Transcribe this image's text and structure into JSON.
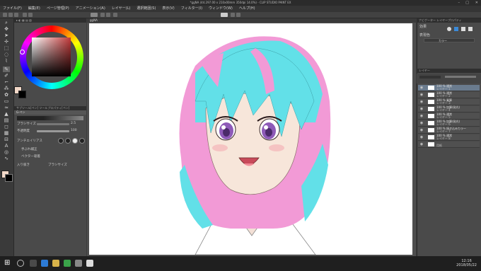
{
  "window": {
    "title": "*ggNA (44.297.00 x 210x00mm 350dpi 14.0%) - CLIP STUDIO PAINT EX"
  },
  "menu": [
    "ファイル(F)",
    "編集(E)",
    "ページ管理(P)",
    "アニメーション(A)",
    "レイヤー(L)",
    "選択範囲(S)",
    "表示(V)",
    "フィルター(I)",
    "ウィンドウ(W)",
    "ヘルプ(H)"
  ],
  "canvas_tab": "ggNA",
  "brush_panel": {
    "header": "サブツール[ペン] ツールプロパティ[ペン]",
    "tool_name": "G-ペン",
    "brush_size_label": "ブラシサイズ",
    "brush_size_value": "2.5",
    "opacity_label": "不透明度",
    "opacity_value": "100",
    "antialias_label": "アンチエイリアス",
    "stabilization_label": "手ぶれ補正",
    "vector_label": "ベクター吸着",
    "input_label": "入り抜き",
    "input_value": "ブラシサイズ"
  },
  "right_panel": {
    "nav_header": "ナビゲーター レイヤープロパティ",
    "effect_label": "効果",
    "expression_label": "表現色",
    "expression_value": "カラー",
    "layer_header": "レイヤー",
    "layers": [
      {
        "mode": "100 % 通常",
        "name": "レイヤー 1",
        "selected": true
      },
      {
        "mode": "100 % 通常",
        "name": "レイヤー 2",
        "selected": false
      },
      {
        "mode": "100 % 乗算",
        "name": "レイヤー 3",
        "selected": false
      },
      {
        "mode": "100 % 加算(発光)",
        "name": "レイヤー 4",
        "selected": false
      },
      {
        "mode": "100 % 通常",
        "name": "レイヤー 5",
        "selected": false
      },
      {
        "mode": "100 % 加算(発光)",
        "name": "レイヤー 6",
        "selected": false
      },
      {
        "mode": "100 % 焼き込みカラー",
        "name": "レイヤー 7",
        "selected": false
      },
      {
        "mode": "100 % 通常",
        "name": "レイヤー 8",
        "selected": false
      },
      {
        "mode": "",
        "name": "用紙",
        "selected": false
      }
    ]
  },
  "taskbar": {
    "time": "12:16",
    "date": "2018/05/22"
  },
  "colors": {
    "main": "#f2d8c8",
    "sub": "#000000",
    "hair_cyan": "#62e0e8",
    "hair_pink": "#f29ad6",
    "eye_purple": "#8e5ab8"
  }
}
